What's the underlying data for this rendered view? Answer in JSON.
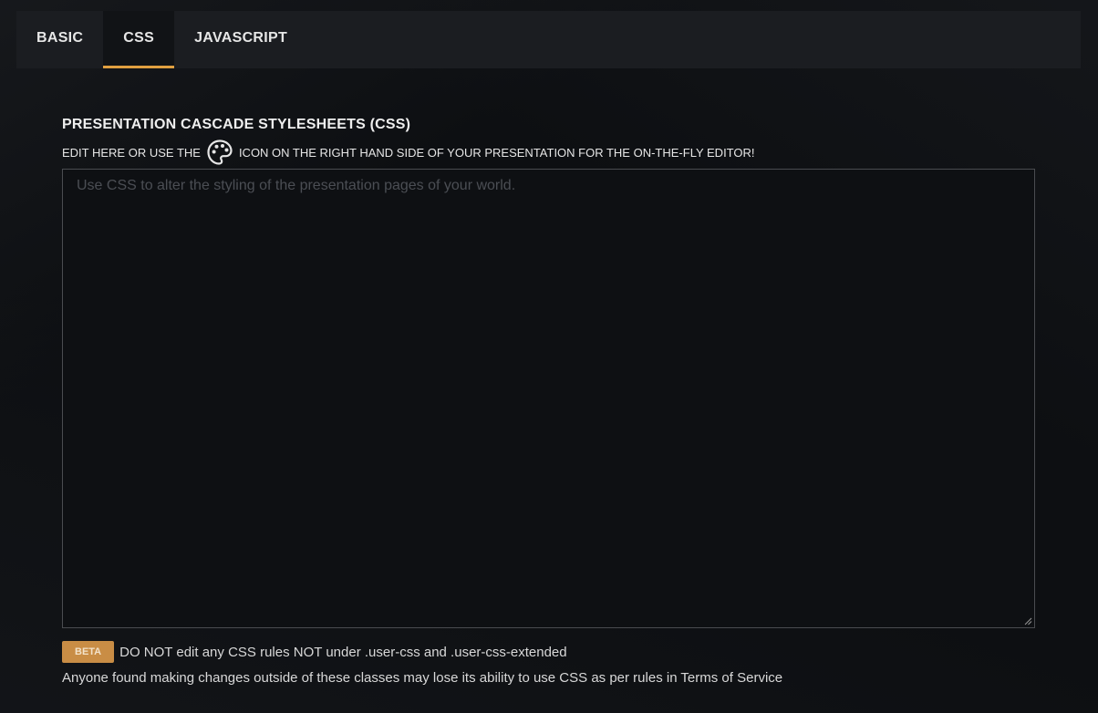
{
  "tabs": [
    {
      "label": "BASIC",
      "active": false
    },
    {
      "label": "CSS",
      "active": true
    },
    {
      "label": "JAVASCRIPT",
      "active": false
    }
  ],
  "section": {
    "title": "PRESENTATION CASCADE STYLESHEETS (CSS)",
    "hint_before": "EDIT HERE OR USE THE",
    "hint_icon": "palette-icon",
    "hint_after": "ICON ON THE RIGHT HAND SIDE OF YOUR PRESENTATION FOR THE ON-THE-FLY EDITOR!"
  },
  "editor": {
    "value": "",
    "placeholder": "Use CSS to alter the styling of the presentation pages of your world."
  },
  "notice": {
    "badge": "BETA",
    "text": "DO NOT edit any CSS rules NOT under .user-css and .user-css-extended"
  },
  "footnote": "Anyone found making changes outside of these classes may lose its ability to use CSS as per rules in Terms of Service",
  "colors": {
    "accent": "#e0a040",
    "badge_bg": "#c98d45",
    "panel_bg": "#1b1d21",
    "page_bg": "#0d0f12"
  }
}
